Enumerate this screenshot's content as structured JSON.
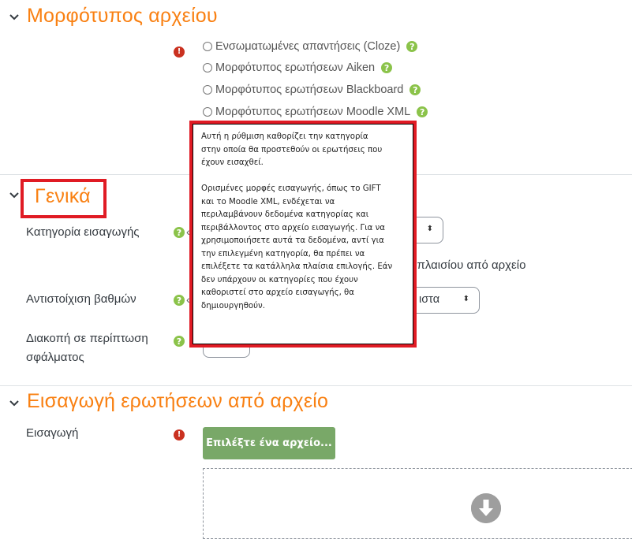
{
  "sections": {
    "file_format": {
      "title": "Μορφότυπος αρχείου"
    },
    "general": {
      "title": "Γενικά"
    },
    "import_file": {
      "title": "Εισαγωγή ερωτήσεων από αρχείο"
    }
  },
  "file_format": {
    "options": [
      "Ενσωματωμένες απαντήσεις (Cloze)",
      "Μορφότυπος ερωτήσεων Aiken",
      "Μορφότυπος ερωτήσεων Blackboard",
      "Μορφότυπος ερωτήσεων Moodle XML"
    ]
  },
  "general": {
    "import_category_label": "Κατηγορία εισαγωγής",
    "context_checkbox_partial": "η πλαισίου από αρχείο",
    "grade_matching_label": "Αντιστοίχιση βαθμών",
    "grade_matching_value_partial": "ιστα",
    "stop_on_error_label_line1": "Διακοπή σε περίπτωση",
    "stop_on_error_label_line2": "σφάλματος"
  },
  "import_file": {
    "import_label": "Εισαγωγή",
    "choose_file_button": "Επιλέξτε ένα αρχείο..."
  },
  "tooltip": {
    "paragraph1": [
      "Αυτή η ρύθμιση καθορίζει την κατηγορία",
      "στην οποία θα προστεθούν οι ερωτήσεις που",
      "έχουν εισαχθεί."
    ],
    "paragraph2": [
      "Ορισμένες μορφές εισαγωγής, όπως το GIFT",
      "και το Moodle XML, ενδέχεται να",
      "περιλαμβάνουν δεδομένα κατηγορίας και",
      "περιβάλλοντος στο αρχείο εισαγωγής. Για να",
      "χρησιμοποιήσετε αυτά τα δεδομένα, αντί για",
      "την επιλεγμένη κατηγορία, θα πρέπει να",
      "επιλέξετε τα κατάλληλα πλαίσια επιλογής. Εάν",
      "δεν υπάρχουν οι κατηγορίες που έχουν",
      "καθοριστεί στο αρχείο εισαγωγής, θα",
      "δημιουργηθούν."
    ]
  },
  "icons": {
    "help": "?",
    "required": "!",
    "chevron": "chevron-down-icon",
    "select_arrows": "⬍"
  },
  "colors": {
    "accent": "#f98012",
    "help_green": "#8bc34a",
    "required_red": "#ca3120",
    "button_green": "#79a868",
    "highlight_red": "#e01b24"
  }
}
